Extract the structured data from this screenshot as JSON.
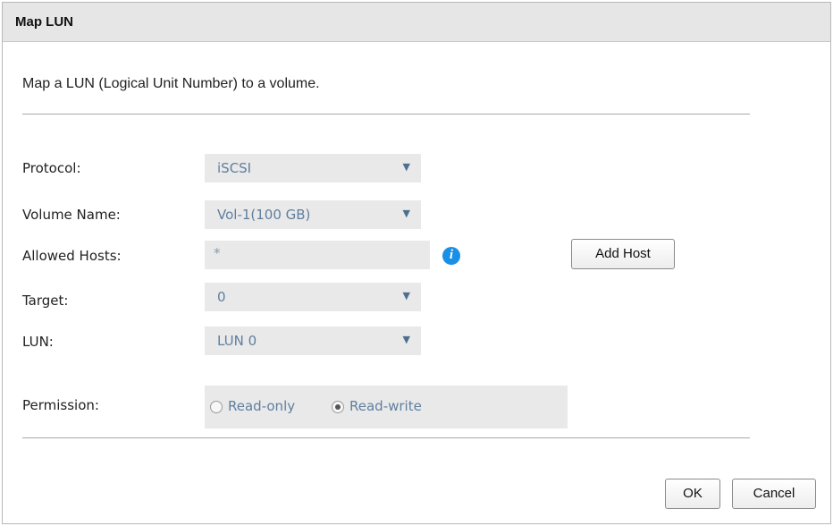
{
  "dialog": {
    "title": "Map LUN",
    "description": "Map a LUN (Logical Unit Number) to a volume."
  },
  "form": {
    "protocol": {
      "label": "Protocol:",
      "value": "iSCSI"
    },
    "volume_name": {
      "label": "Volume Name:",
      "value": "Vol-1(100 GB)"
    },
    "allowed_hosts": {
      "label": "Allowed Hosts:",
      "value": "*",
      "info_icon": "info-icon"
    },
    "add_host_label": "Add Host",
    "target": {
      "label": "Target:",
      "value": "0"
    },
    "lun": {
      "label": "LUN:",
      "value": "LUN 0"
    },
    "permission": {
      "label": "Permission:",
      "options": [
        "Read-only",
        "Read-write"
      ],
      "selected": "Read-write"
    }
  },
  "buttons": {
    "ok_label": "OK",
    "cancel_label": "Cancel"
  },
  "colors": {
    "titlebar_bg": "#e6e6e6",
    "field_bg": "#e9e9e9",
    "field_text": "#5f7f9f",
    "info_icon": "#1a8fe6"
  }
}
